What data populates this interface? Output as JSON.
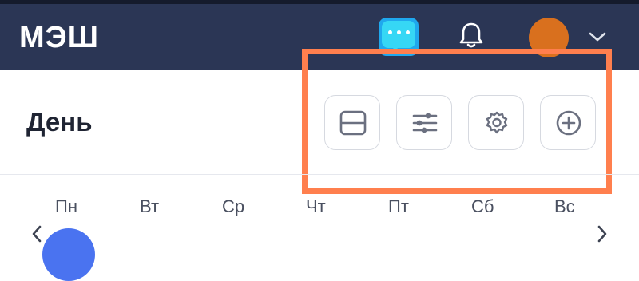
{
  "header": {
    "logo": "МЭШ",
    "icons": [
      "chat-icon",
      "bell-icon",
      "chevron-down-icon"
    ],
    "avatar_color": "#d9701e",
    "background": "#2b3655"
  },
  "page": {
    "title": "День"
  },
  "toolbar": {
    "buttons": [
      "layout-icon",
      "sliders-icon",
      "gear-icon",
      "plus-circle-icon"
    ],
    "highlight_color": "#ff7f4e"
  },
  "calendar": {
    "weekdays": [
      "Пн",
      "Вт",
      "Ср",
      "Чт",
      "Пт",
      "Сб",
      "Вс"
    ],
    "selected_color": "#4a73f0"
  }
}
